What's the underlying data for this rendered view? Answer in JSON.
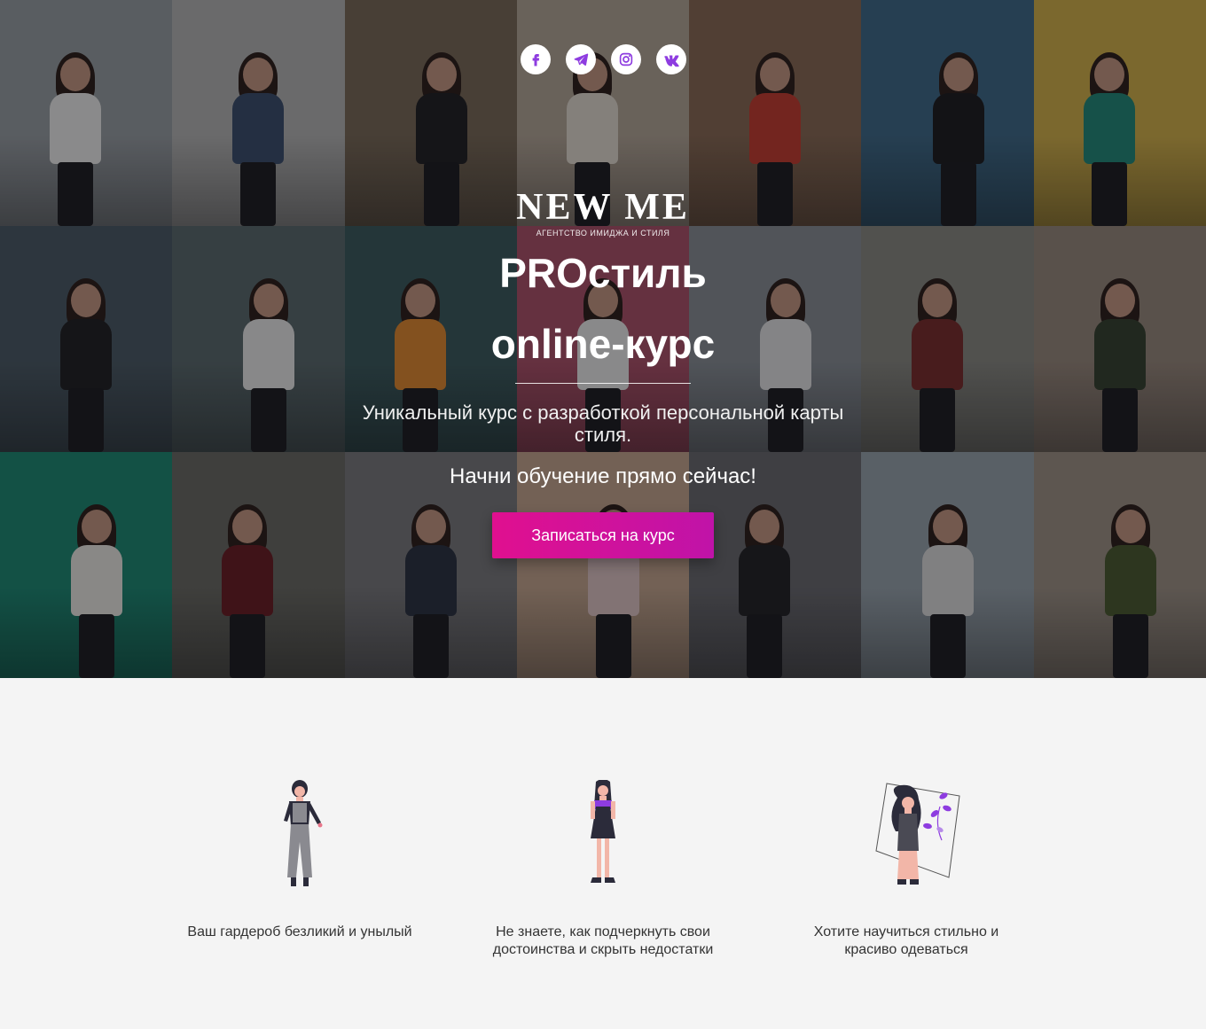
{
  "social": [
    {
      "name": "facebook-icon",
      "glyph": "f"
    },
    {
      "name": "telegram-icon",
      "glyph": "t"
    },
    {
      "name": "instagram-icon",
      "glyph": "i"
    },
    {
      "name": "vk-icon",
      "glyph": "vk"
    }
  ],
  "brand": {
    "logo": "NEW ME",
    "tagline": "АГЕНТСТВО ИМИДЖА И СТИЛЯ"
  },
  "hero": {
    "title_line1": "PROстиль",
    "title_line2": "online-курс",
    "subtitle": "Уникальный курс с разработкой персональной карты стиля.",
    "cta_text": "Начни обучение прямо сейчас!",
    "cta_button": "Записаться на курс"
  },
  "colors": {
    "accent": "#e0108f",
    "accent_end": "#c013a8",
    "icon_purple": "#8e3ce0"
  },
  "photo_tiles": [
    {
      "bg": "#9aa0a6",
      "top": "#f2f2f2",
      "name": "photo-street-crosswalk"
    },
    {
      "bg": "#b8b8b8",
      "top": "#3a4d6e",
      "name": "photo-wood-wall-jump"
    },
    {
      "bg": "#7a6a58",
      "top": "#1e1e22",
      "name": "photo-black-jacket"
    },
    {
      "bg": "#b7a99a",
      "top": "#e8e0d6",
      "name": "photo-city-shorts"
    },
    {
      "bg": "#8a6a54",
      "top": "#c83b2e",
      "name": "photo-red-tee"
    },
    {
      "bg": "#3d6a8a",
      "top": "#1a1a1e",
      "name": "photo-black-crop"
    },
    {
      "bg": "#d8b54a",
      "top": "#1f8a7a",
      "name": "photo-yellow-wall"
    },
    {
      "bg": "#4a5a66",
      "top": "#1e1e22",
      "name": "photo-black-bra"
    },
    {
      "bg": "#5a6a6e",
      "top": "#eeeeee",
      "name": "photo-white-tee-sit"
    },
    {
      "bg": "#3a5a5e",
      "top": "#e68a2e",
      "name": "photo-orange-sweater"
    },
    {
      "bg": "#b0506a",
      "top": "#f0f0f0",
      "name": "photo-pink-portrait"
    },
    {
      "bg": "#8a9098",
      "top": "#e8e8ea",
      "name": "photo-steps-sit"
    },
    {
      "bg": "#8a8a84",
      "top": "#7a2b2a",
      "name": "photo-plaid-pants"
    },
    {
      "bg": "#9a8a7e",
      "top": "#34402e",
      "name": "photo-hat-jacket"
    },
    {
      "bg": "#1a8a74",
      "top": "#f0eeea",
      "name": "photo-green-wall"
    },
    {
      "bg": "#6a6a64",
      "top": "#6a1a22",
      "name": "photo-red-coat"
    },
    {
      "bg": "#7a7a7e",
      "top": "#283040",
      "name": "photo-plaid-coat"
    },
    {
      "bg": "#c8a890",
      "top": "#e4c8c8",
      "name": "photo-floral-top"
    },
    {
      "bg": "#6a6a70",
      "top": "#202024",
      "name": "photo-black-coat-sneakers"
    },
    {
      "bg": "#9aa6b0",
      "top": "#e0e0e0",
      "name": "photo-brick-wall-kick"
    },
    {
      "bg": "#a09488",
      "top": "#4a5a2e",
      "name": "photo-olive-hoodie"
    }
  ],
  "features": [
    {
      "text": "Ваш гардероб безликий и унылый",
      "icon": "woman-gray-jumpsuit-illustration"
    },
    {
      "text": "Не знаете, как подчеркнуть свои достоинства и скрыть недостатки",
      "icon": "woman-purple-dress-illustration"
    },
    {
      "text": "Хотите научиться стильно и красиво одеваться",
      "icon": "woman-flowers-illustration"
    }
  ]
}
